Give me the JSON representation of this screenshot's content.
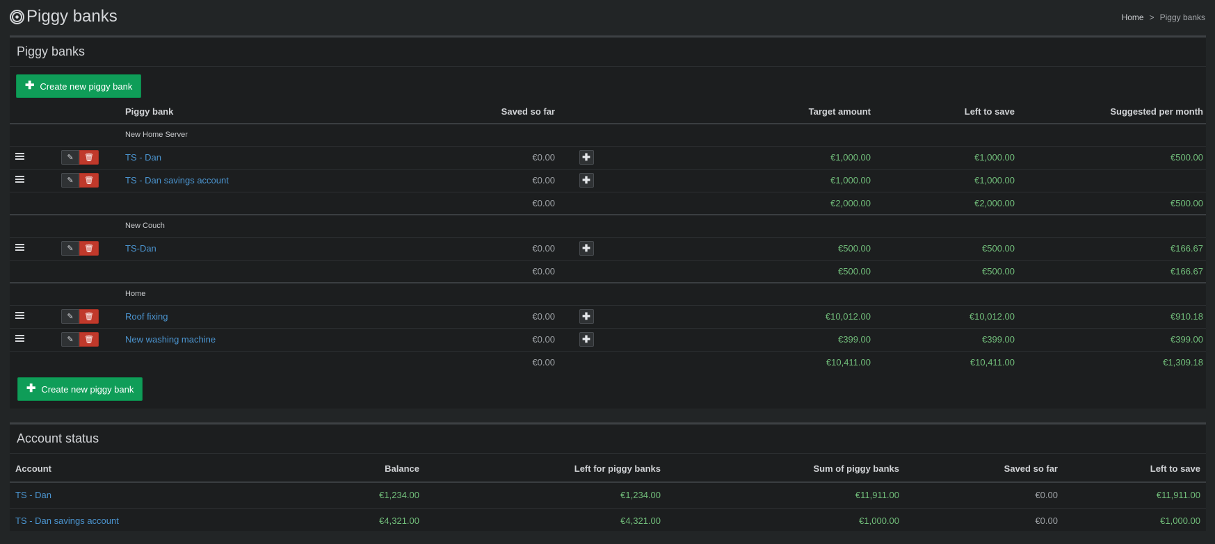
{
  "header": {
    "title": "Piggy banks",
    "breadcrumb_home": "Home",
    "breadcrumb_sep": ">",
    "breadcrumb_current": "Piggy banks"
  },
  "piggy_box": {
    "title": "Piggy banks",
    "create_button_label": "Create new piggy bank",
    "columns": [
      "Piggy bank",
      "Saved so far",
      "Target amount",
      "Left to save",
      "Suggested per month"
    ],
    "groups": [
      {
        "name": "New Home Server",
        "rows": [
          {
            "name": "TS - Dan",
            "saved": "€0.00",
            "target": "€1,000.00",
            "left": "€1,000.00",
            "monthly": "€500.00"
          },
          {
            "name": "TS - Dan savings account",
            "saved": "€0.00",
            "target": "€1,000.00",
            "left": "€1,000.00",
            "monthly": ""
          }
        ],
        "total": {
          "saved": "€0.00",
          "target": "€2,000.00",
          "left": "€2,000.00",
          "monthly": "€500.00"
        }
      },
      {
        "name": "New Couch",
        "rows": [
          {
            "name": "TS-Dan",
            "saved": "€0.00",
            "target": "€500.00",
            "left": "€500.00",
            "monthly": "€166.67"
          }
        ],
        "total": {
          "saved": "€0.00",
          "target": "€500.00",
          "left": "€500.00",
          "monthly": "€166.67"
        }
      },
      {
        "name": "Home",
        "rows": [
          {
            "name": "Roof fixing",
            "saved": "€0.00",
            "target": "€10,012.00",
            "left": "€10,012.00",
            "monthly": "€910.18"
          },
          {
            "name": "New washing machine",
            "saved": "€0.00",
            "target": "€399.00",
            "left": "€399.00",
            "monthly": "€399.00"
          }
        ],
        "total": {
          "saved": "€0.00",
          "target": "€10,411.00",
          "left": "€10,411.00",
          "monthly": "€1,309.18"
        }
      }
    ]
  },
  "account_box": {
    "title": "Account status",
    "columns": [
      "Account",
      "Balance",
      "Left for piggy banks",
      "Sum of piggy banks",
      "Saved so far",
      "Left to save"
    ],
    "rows": [
      {
        "account": "TS - Dan",
        "balance": "€1,234.00",
        "left_for_piggy": "€1,234.00",
        "sum_piggy": "€11,911.00",
        "saved": "€0.00",
        "left": "€11,911.00"
      },
      {
        "account": "TS - Dan savings account",
        "balance": "€4,321.00",
        "left_for_piggy": "€4,321.00",
        "sum_piggy": "€1,000.00",
        "saved": "€0.00",
        "left": "€1,000.00"
      }
    ]
  },
  "icons": {
    "logo": "piggy-bank-target-icon",
    "drag": "bars-icon",
    "edit": "pencil-icon",
    "delete": "trash-icon",
    "add_money": "plus-icon"
  },
  "colors": {
    "background": "#222526",
    "panel": "#1c1e1f",
    "create_button": "#0f9d58",
    "delete_button": "#c0392b",
    "money_positive": "#71bd7a",
    "link": "#4b94cf"
  }
}
